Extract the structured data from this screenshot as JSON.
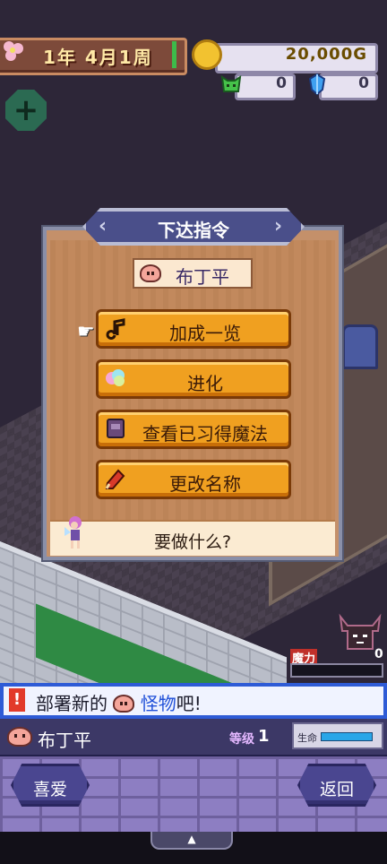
{
  "hud": {
    "date": "1年 4月1周",
    "gold": "20,000G",
    "resource_1": "0",
    "resource_2": "0"
  },
  "dialog": {
    "title": "下达指令",
    "monster_name": "布丁平",
    "menu": [
      {
        "label": "加成一览",
        "icon": "music-note-icon"
      },
      {
        "label": "进化",
        "icon": "cloud-icon"
      },
      {
        "label": "查看已习得魔法",
        "icon": "spellbook-icon"
      },
      {
        "label": "更改名称",
        "icon": "pencil-icon"
      }
    ],
    "prompt": "要做什么?"
  },
  "mana": {
    "label": "魔力",
    "value": "0"
  },
  "message": {
    "part1": "部署新的",
    "part2": "怪物",
    "part3": "吧!"
  },
  "status": {
    "name": "布丁平",
    "level_label": "等级",
    "level": "1",
    "hp_label": "生命"
  },
  "buttons": {
    "favorite": "喜爱",
    "back": "返回"
  },
  "colors": {
    "accent_blue": "#2e5bd6",
    "menu_orange": "#f0a020",
    "highlight_text": "#2050d8"
  }
}
